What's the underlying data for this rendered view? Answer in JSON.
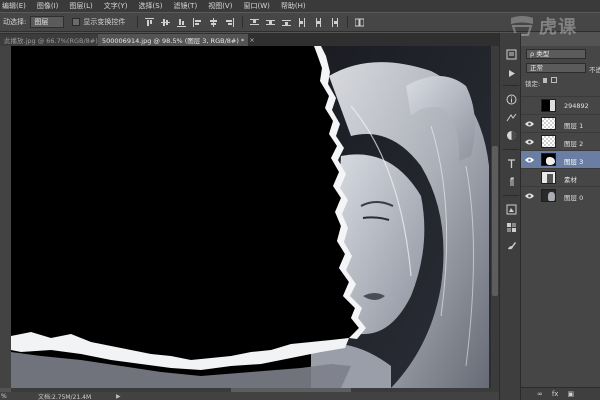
{
  "menu": [
    "编辑(E)",
    "图像(I)",
    "图层(L)",
    "文字(Y)",
    "选择(S)",
    "滤镜(T)",
    "视图(V)",
    "窗口(W)",
    "帮助(H)"
  ],
  "options_bar": {
    "auto_select_label": "动选择:",
    "auto_select_value": "图层",
    "show_transform_label": "显示变换控件"
  },
  "watermark": "虎课",
  "tabs": [
    {
      "label": "此播放.jpg @ 66.7%(RGB/8#)",
      "close": "×",
      "active": false
    },
    {
      "label": "500006914.jpg @ 98.5% (图层 3, RGB/8#) *",
      "close": "×",
      "active": true
    }
  ],
  "status_bar": {
    "zoom": "%",
    "doc_info": "文档:2.75M/21.4M",
    "arrow": "▶"
  },
  "layers_panel": {
    "filter_value": "ρ 类型",
    "blend_mode": "正常",
    "opacity_label": "不透",
    "lock_label": "锁定:",
    "layers": [
      {
        "name": "294892",
        "visible": false,
        "selected": false,
        "thumb": "black-mask"
      },
      {
        "name": "图层 1",
        "visible": true,
        "selected": false,
        "thumb": "checker"
      },
      {
        "name": "图层 2",
        "visible": true,
        "selected": false,
        "thumb": "checker"
      },
      {
        "name": "图层 3",
        "visible": true,
        "selected": true,
        "thumb": "white-blob"
      },
      {
        "name": "素材",
        "visible": false,
        "selected": false,
        "thumb": "photo-small"
      },
      {
        "name": "图层 0",
        "visible": true,
        "selected": false,
        "thumb": "photo-dark"
      }
    ],
    "footer_icons": [
      "∞",
      "fx",
      "▣",
      "◐",
      "□",
      "▤",
      "⌂"
    ]
  }
}
